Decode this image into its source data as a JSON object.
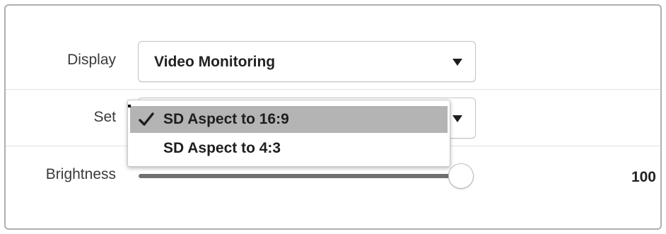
{
  "display": {
    "label": "Display",
    "selected": "Video Monitoring",
    "arrow_icon": "triangle-down-icon"
  },
  "set": {
    "label": "Set",
    "selected": "SD Aspect to 16:9",
    "arrow_icon": "triangle-down-icon",
    "menu": {
      "items": [
        {
          "label": "SD Aspect to 16:9",
          "checked": true
        },
        {
          "label": "SD Aspect to 4:3",
          "checked": false
        }
      ],
      "check_icon": "checkmark-icon"
    }
  },
  "brightness": {
    "label": "Brightness",
    "value": "100",
    "level": 1.0
  },
  "colors": {
    "selected_item_bg": "#b4b4b4",
    "slider_track": "#6f6f6f",
    "border": "#b0b0b0"
  }
}
